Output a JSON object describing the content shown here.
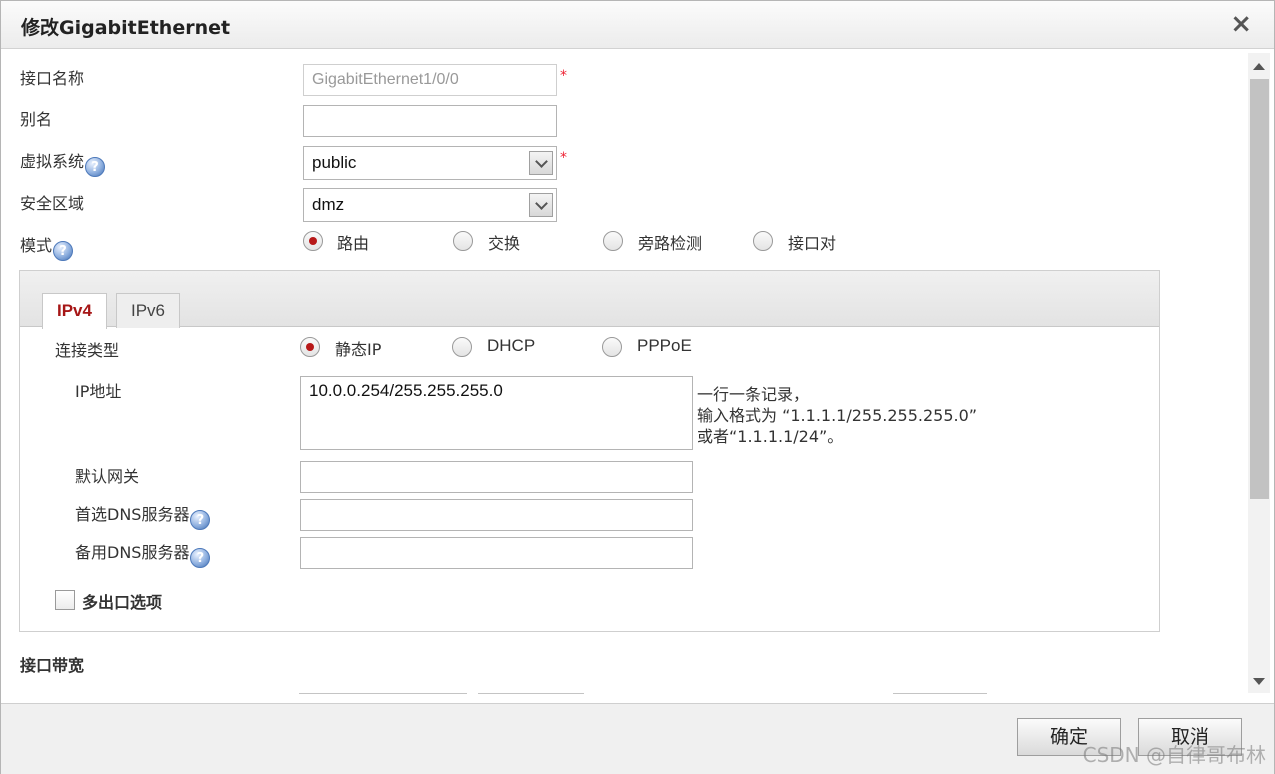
{
  "dialog": {
    "title": "修改GigabitEthernet",
    "close_glyph": "×"
  },
  "form": {
    "interface_name": {
      "label": "接口名称",
      "value": "GigabitEthernet1/0/0",
      "required": "*"
    },
    "alias": {
      "label": "别名",
      "value": ""
    },
    "vsys": {
      "label": "虚拟系统",
      "value": "public",
      "required": "*"
    },
    "zone": {
      "label": "安全区域",
      "value": "dmz"
    },
    "mode": {
      "label": "模式",
      "options": [
        "路由",
        "交换",
        "旁路检测",
        "接口对"
      ],
      "selected": "路由"
    },
    "help_glyph": "?"
  },
  "tabs": [
    {
      "label": "IPv4",
      "active": true
    },
    {
      "label": "IPv6",
      "active": false
    }
  ],
  "ipv4": {
    "conn_type": {
      "label": "连接类型",
      "options": [
        "静态IP",
        "DHCP",
        "PPPoE"
      ],
      "selected": "静态IP"
    },
    "ip_address": {
      "label": "IP地址",
      "value": "10.0.0.254/255.255.255.0",
      "hint": [
        "一行一条记录，",
        "输入格式为 “1.1.1.1/255.255.255.0”",
        "或者“1.1.1.1/24”。"
      ]
    },
    "gateway": {
      "label": "默认网关",
      "value": ""
    },
    "dns_primary": {
      "label": "首选DNS服务器",
      "value": ""
    },
    "dns_backup": {
      "label": "备用DNS服务器",
      "value": ""
    },
    "multi_exit": {
      "label": "多出口选项",
      "checked": false
    }
  },
  "bandwidth": {
    "label": "接口带宽"
  },
  "footer": {
    "confirm": "确定",
    "cancel": "取消"
  },
  "watermark": "CSDN @自律哥布林",
  "colors": {
    "accent_red": "#b71818",
    "tab_active_text": "#a61616"
  }
}
